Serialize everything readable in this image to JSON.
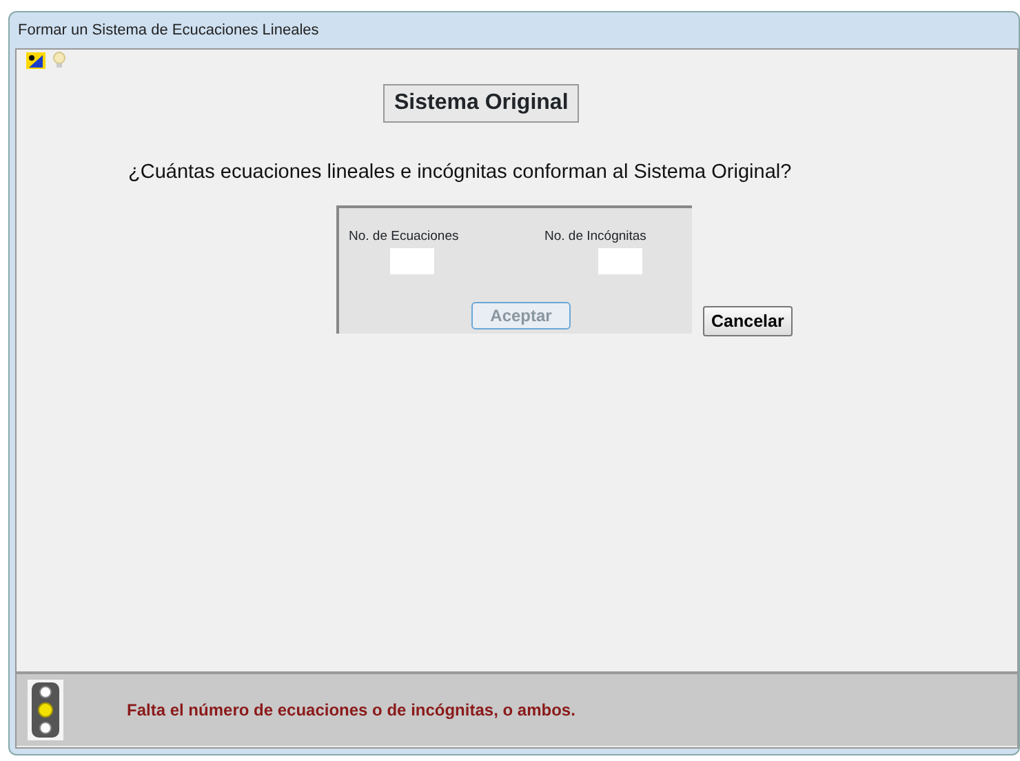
{
  "window": {
    "title": "Formar un Sistema de Ecucaciones Lineales"
  },
  "heading": "Sistema Original",
  "question": "¿Cuántas ecuaciones lineales e incógnitas conforman al Sistema Original?",
  "panel": {
    "fields": [
      {
        "label": "No. de Ecuaciones"
      },
      {
        "label": "No. de Incógnitas"
      }
    ],
    "accept_button": {
      "label": "Aceptar",
      "disabled": true
    }
  },
  "cancel_button": {
    "label": "Cancelar",
    "disabled": false
  },
  "status_bar": {
    "lamps": [
      {
        "color": "#ffffff",
        "on": false
      },
      {
        "color": "#f2e000",
        "on": true
      },
      {
        "color": "#ffffff",
        "on": false
      }
    ],
    "message": "Falta el número de ecuaciones o de incógnitas, o ambos."
  }
}
